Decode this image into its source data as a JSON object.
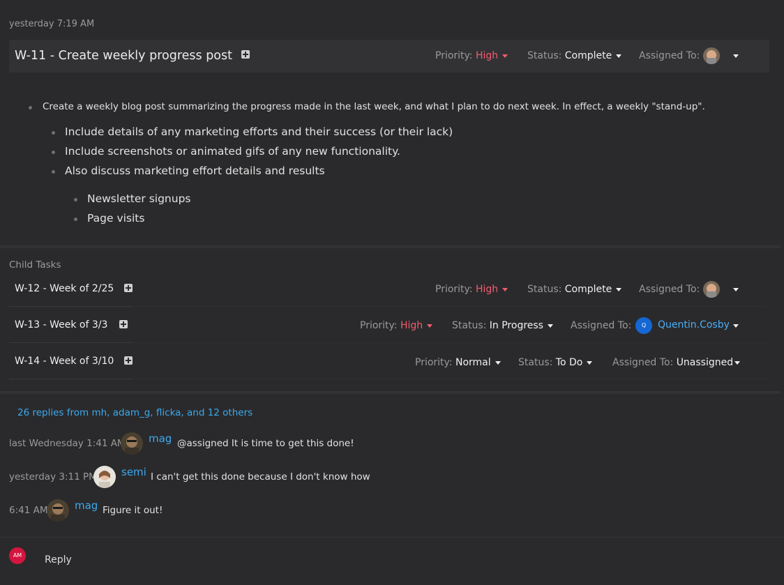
{
  "timestamp": "yesterday 7:19 AM",
  "task": {
    "id_title": "W-11 - Create weekly progress post",
    "priority_label": "Priority:",
    "priority": "High",
    "status_label": "Status:",
    "status": "Complete",
    "assigned_label": "Assigned To:"
  },
  "description": {
    "item1": "Create a weekly blog post summarizing the progress made in the last week, and what I plan to do next week. In effect, a weekly \"stand-up\".",
    "sub1": "Include details of any marketing efforts and their success (or their lack)",
    "sub2": "Include screenshots or animated gifs of any new functionality.",
    "sub3": "Also discuss marketing effort details and results",
    "subsub1": "Newsletter signups",
    "subsub2": "Page visits"
  },
  "child_tasks": {
    "label": "Child Tasks",
    "rows": [
      {
        "title": "W-12 - Week of 2/25",
        "priority_label": "Priority:",
        "priority": "High",
        "status_label": "Status:",
        "status": "Complete",
        "assigned_label": "Assigned To:",
        "assignee": ""
      },
      {
        "title": "W-13 - Week of 3/3",
        "priority_label": "Priority:",
        "priority": "High",
        "status_label": "Status:",
        "status": "In Progress",
        "assigned_label": "Assigned To:",
        "assignee": "Quentin.Cosby",
        "assignee_initial": "Q"
      },
      {
        "title": "W-14 - Week of 3/10",
        "priority_label": "Priority:",
        "priority": "Normal",
        "status_label": "Status:",
        "status": "To Do",
        "assigned_label": "Assigned To:",
        "assignee": "Unassigned"
      }
    ]
  },
  "replies_summary": "26 replies from mh, adam_g, flicka, and 12 others",
  "comments": [
    {
      "time": "last Wednesday 1:41 AM",
      "user": "mag",
      "message": "@assigned It is time to get this done!"
    },
    {
      "time": "yesterday 3:11 PM",
      "user": "semi",
      "message": "I can't get this done because I don't know how"
    },
    {
      "time": "6:41 AM",
      "user": "mag",
      "message": "Figure it out!"
    }
  ],
  "reply": {
    "avatar_initials": "AM",
    "label": "Reply"
  },
  "colors": {
    "background": "#2a2a2c",
    "high": "#f25c6e",
    "link": "#3aaaf0",
    "reply_avatar": "#d3153f"
  }
}
